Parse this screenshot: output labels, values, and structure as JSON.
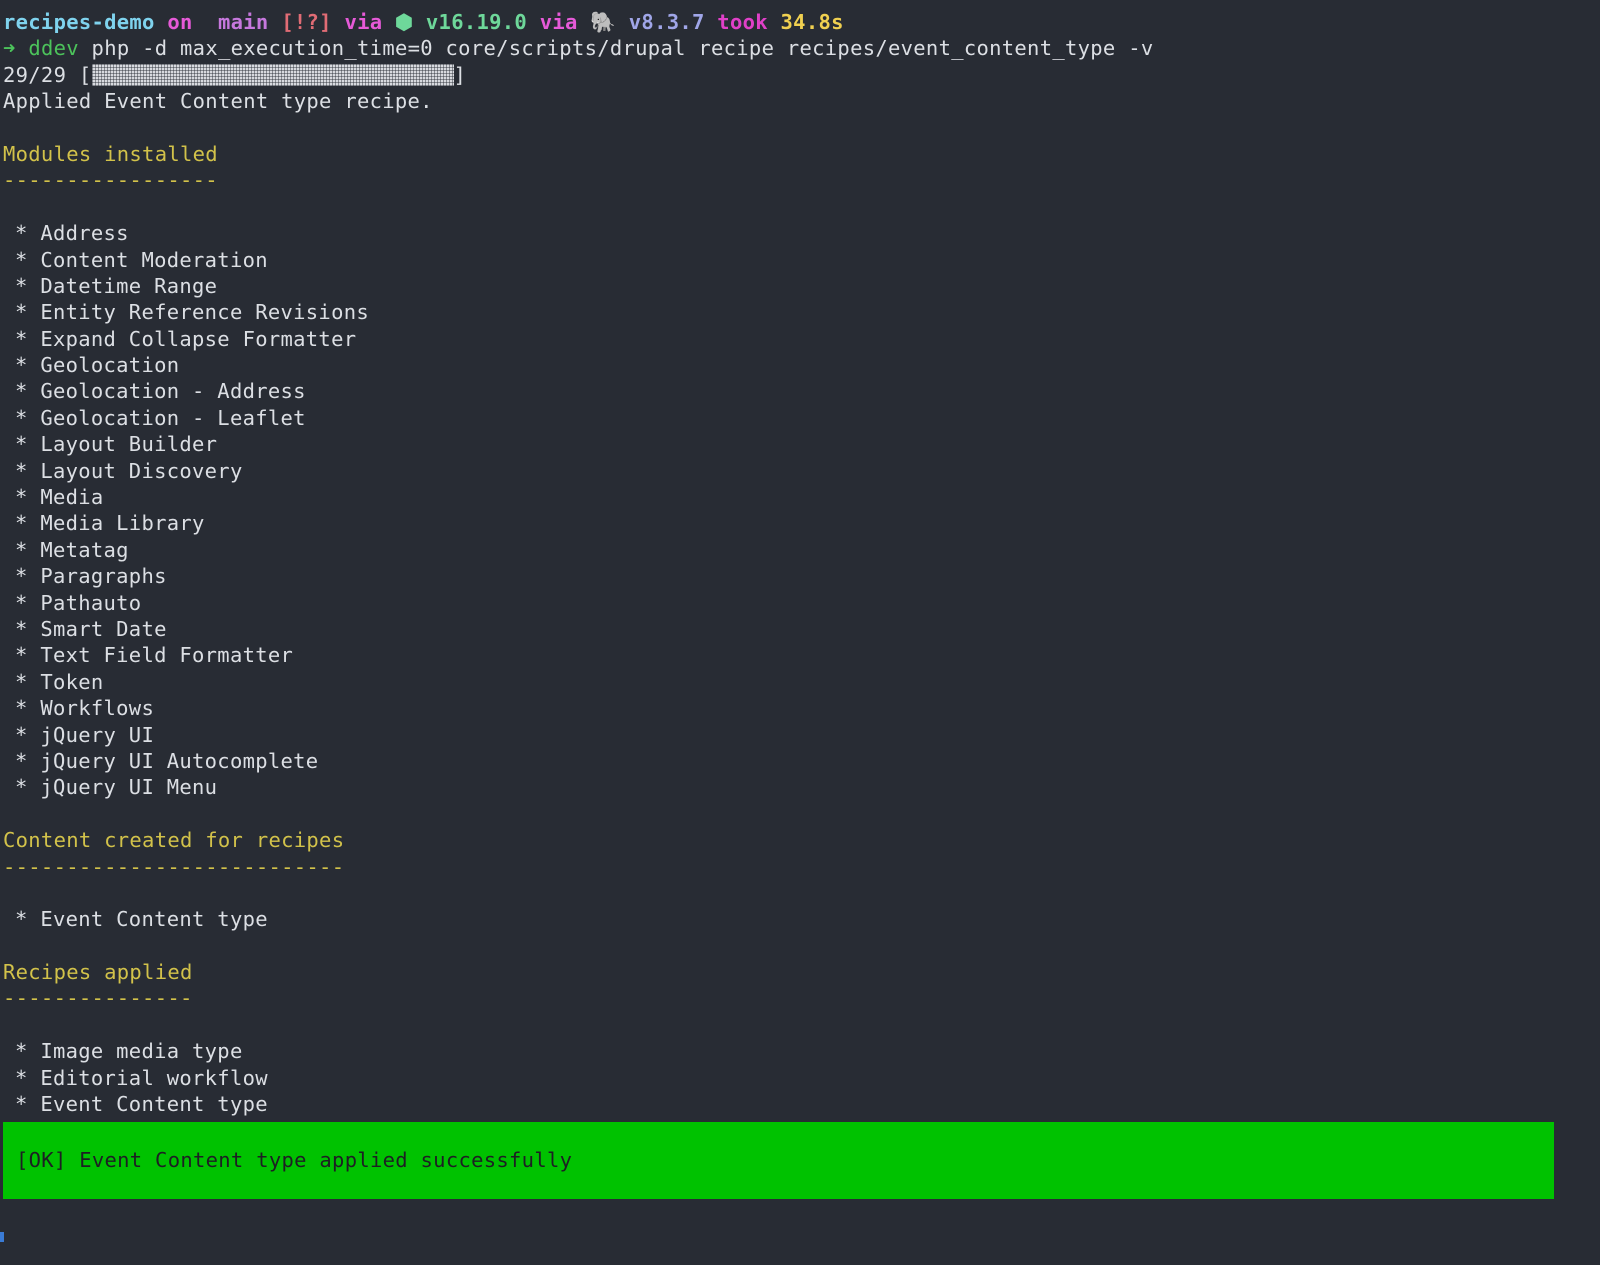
{
  "prompt": {
    "dir": "recipes-demo",
    "on": "on",
    "branch_icon": "",
    "branch": "main",
    "status": "[!?]",
    "via1": "via",
    "node_icon": "⬢",
    "node_version": "v16.19.0",
    "via2": "via",
    "php_icon": "🐘",
    "php_version": "v8.3.7",
    "took": "took",
    "duration": "34.8s"
  },
  "command": {
    "arrow": "➜",
    "tool": "ddev",
    "args": "php -d max_execution_time=0 core/scripts/drupal recipe recipes/event_content_type -v"
  },
  "progress": {
    "count": "29/29",
    "open": "[",
    "close": "]",
    "fraction": 1.0
  },
  "applied_message": "Applied Event Content type recipe.",
  "sections": {
    "modules": {
      "title": "Modules installed",
      "underline": "-----------------",
      "items": [
        "Address",
        "Content Moderation",
        "Datetime Range",
        "Entity Reference Revisions",
        "Expand Collapse Formatter",
        "Geolocation",
        "Geolocation - Address",
        "Geolocation - Leaflet",
        "Layout Builder",
        "Layout Discovery",
        "Media",
        "Media Library",
        "Metatag",
        "Paragraphs",
        "Pathauto",
        "Smart Date",
        "Text Field Formatter",
        "Token",
        "Workflows",
        "jQuery UI",
        "jQuery UI Autocomplete",
        "jQuery UI Menu"
      ]
    },
    "content": {
      "title": "Content created for recipes",
      "underline": "---------------------------",
      "items": [
        "Event Content type"
      ]
    },
    "recipes": {
      "title": "Recipes applied",
      "underline": "---------------",
      "items": [
        "Image media type",
        "Editorial workflow",
        "Event Content type"
      ]
    }
  },
  "bullet": "*",
  "ok_banner": "[OK] Event Content type applied successfully",
  "colors": {
    "background": "#282c34",
    "ok_background": "#00c200",
    "heading": "#d2c24a",
    "command": "#4cc35b"
  }
}
